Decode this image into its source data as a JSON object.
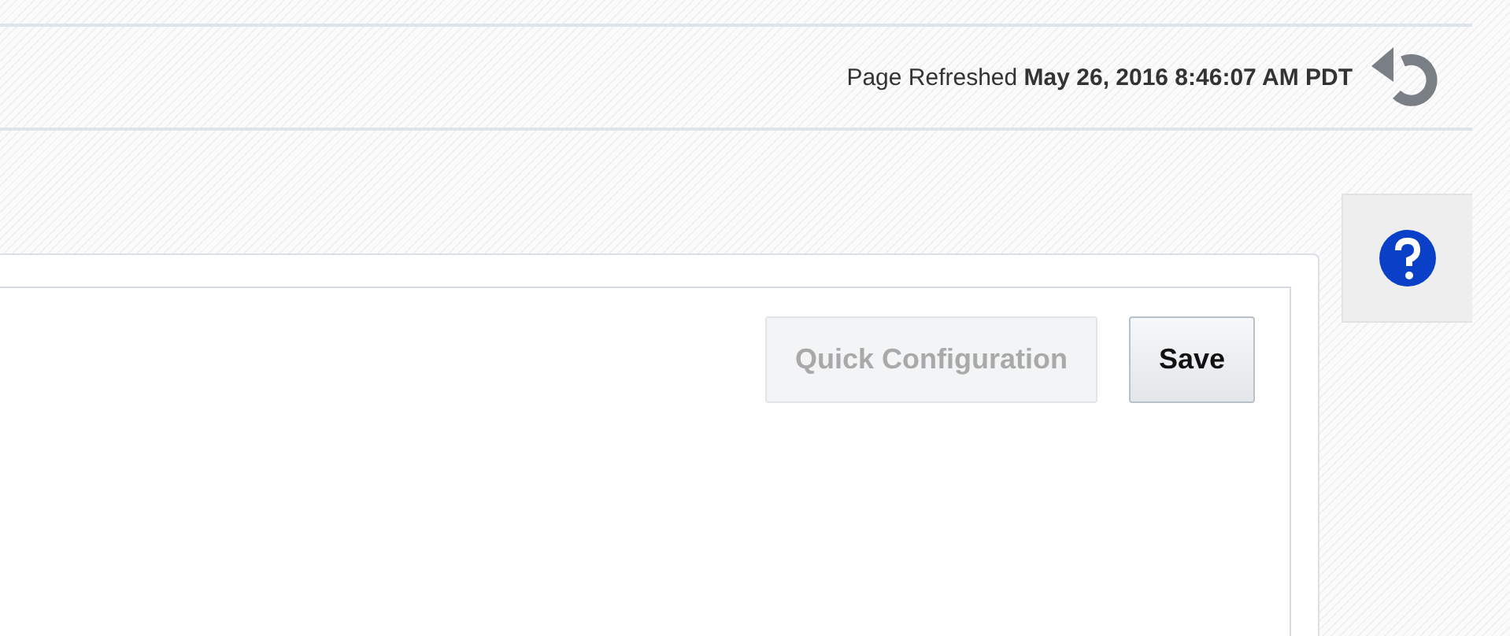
{
  "status_bar": {
    "text": "Page Refreshed **May 26, 2016 8:46:07 AM PDT**"
  },
  "toolbar": {
    "buttons": [
      {
        "label": "Quick Configuration",
        "disabled": true
      },
      {
        "label": "Save",
        "disabled": false
      }
    ]
  }
}
